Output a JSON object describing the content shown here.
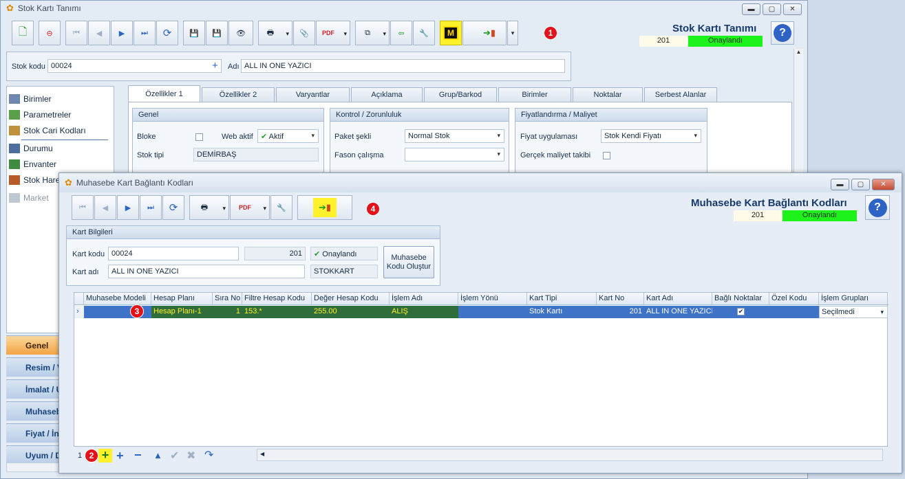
{
  "main_window": {
    "title": "Stok Kartı Tanımı",
    "header_title": "Stok Kartı Tanımı",
    "record_no": "201",
    "status": "Onaylandı"
  },
  "stock": {
    "code_label": "Stok kodu",
    "code_value": "00024",
    "name_label": "Adı",
    "name_value": "ALL IN ONE YAZICI"
  },
  "nav_items": [
    {
      "label": "Birimler"
    },
    {
      "label": "Parametreler"
    },
    {
      "label": "Stok Cari Kodları"
    },
    {
      "label": "Durumu"
    },
    {
      "label": "Envanter"
    },
    {
      "label": "Stok Hare"
    },
    {
      "label": "Market"
    }
  ],
  "side_buttons": [
    {
      "label": "Genel"
    },
    {
      "label": "Resim / V"
    },
    {
      "label": "İmalat / U"
    },
    {
      "label": "Muhasebe"
    },
    {
      "label": "Fiyat / İn"
    },
    {
      "label": "Uyum / D"
    }
  ],
  "tabs": [
    {
      "label": "Özellikler 1"
    },
    {
      "label": "Özellikler 2"
    },
    {
      "label": "Varyantlar"
    },
    {
      "label": "Açıklama"
    },
    {
      "label": "Grup/Barkod"
    },
    {
      "label": "Birimler"
    },
    {
      "label": "Noktalar"
    },
    {
      "label": "Serbest Alanlar"
    }
  ],
  "groups": {
    "genel": {
      "title": "Genel",
      "bloke": "Bloke",
      "web_aktif": "Web aktif",
      "web_aktif_value": "Aktif",
      "stok_tipi": "Stok tipi",
      "stok_tipi_value": "DEMİRBAŞ"
    },
    "kontrol": {
      "title": "Kontrol / Zorunluluk",
      "paket": "Paket şekli",
      "paket_value": "Normal Stok",
      "fason": "Fason çalışma",
      "fason_value": ""
    },
    "fiyat": {
      "title": "Fiyatlandırma / Maliyet",
      "uygulama": "Fiyat uygulaması",
      "uygulama_value": "Stok Kendi Fiyatı",
      "gercek": "Gerçek maliyet takibi"
    }
  },
  "dialog": {
    "title": "Muhasebe Kart Bağlantı Kodları",
    "header_title": "Muhasebe Kart Bağlantı Kodları",
    "record_no": "201",
    "status": "Onaylandı",
    "kart_bilgileri": "Kart Bilgileri",
    "kart_kodu_label": "Kart kodu",
    "kart_kodu_value": "00024",
    "kart_no_value": "201",
    "onay_value": "Onaylandı",
    "kart_adi_label": "Kart adı",
    "kart_adi_value": "ALL IN ONE YAZICI",
    "kart_tipi_value": "STOKKART",
    "olustur_button": "Muhasebe Kodu Oluştur"
  },
  "grid": {
    "columns": [
      "Muhasebe Modeli",
      "Hesap Planı",
      "Sıra No",
      "Filtre Hesap Kodu",
      "Değer Hesap Kodu",
      "İşlem Adı",
      "İşlem Yönü",
      "Kart Tipi",
      "Kart No",
      "Kart Adı",
      "Bağlı Noktalar",
      "Özel Kodu",
      "İşlem Grupları"
    ],
    "row": {
      "model": "",
      "hesap_plani": "Hesap Planı-1",
      "sira_no": "1",
      "filtre": "153.*",
      "deger": "255.00",
      "islem_adi": "ALIŞ",
      "islem_yonu": "",
      "kart_tipi": "Stok Kartı",
      "kart_no": "201",
      "kart_adi": "ALL IN ONE YAZICI",
      "ozel_kodu": "",
      "islem_gruplari": "Seçilmedi"
    },
    "record_counter": "1"
  },
  "annotations": [
    "1",
    "2",
    "3",
    "4"
  ],
  "colors": {
    "accent_status": "#1df31a",
    "highlight": "#fff22a",
    "badge": "#e4111b",
    "row_selected": "#3f73c8",
    "row_dark": "#2f6e3a"
  }
}
